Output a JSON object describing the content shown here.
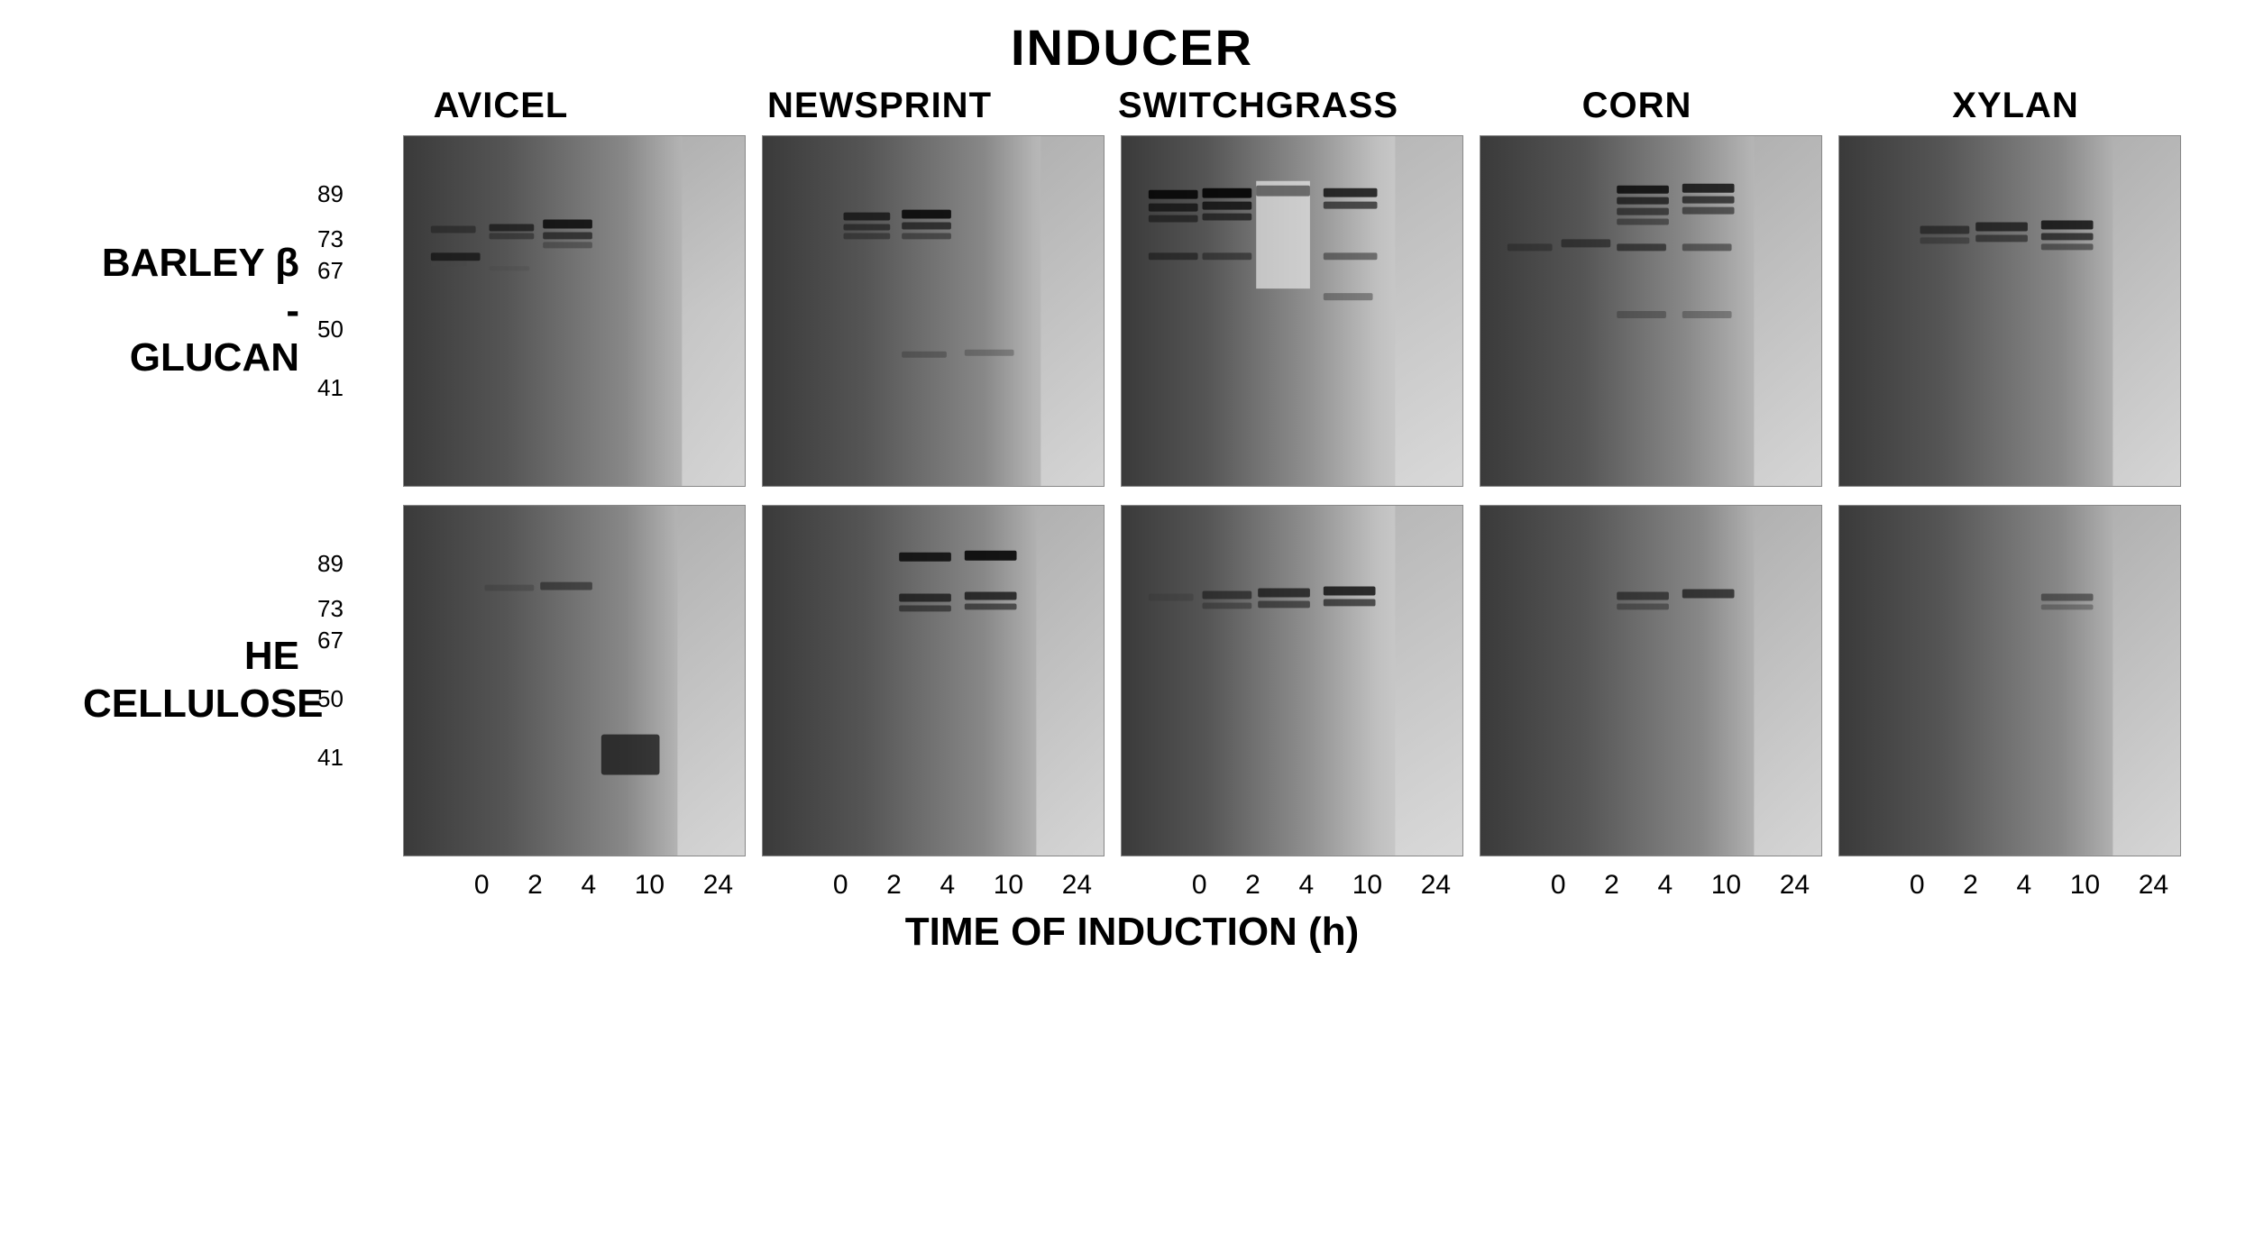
{
  "title": "INDUCER",
  "inducer_columns": [
    "AVICEL",
    "NEWSPRINT",
    "SWITCHGRASS",
    "CORN",
    "XYLAN"
  ],
  "row_labels": [
    "BARLEY β -\nGLUCAN",
    "HE\nCELLULOSE"
  ],
  "ladder_values": [
    "89",
    "73",
    "67",
    "50",
    "41"
  ],
  "time_points": [
    "0",
    "2",
    "4",
    "10",
    "24"
  ],
  "time_axis_label": "TIME OF INDUCTION (h)",
  "gel_rows": [
    {
      "name": "barley-beta-glucan",
      "label_line1": "BARLEY β -",
      "label_line2": "GLUCAN"
    },
    {
      "name": "he-cellulose",
      "label_line1": "HE",
      "label_line2": "CELLULOSE"
    }
  ],
  "colors": {
    "background": "#ffffff",
    "gel_dark": "#3a3a3a",
    "gel_mid": "#787878",
    "gel_light": "#d0d0d0",
    "band_dark": "#1a1a1a",
    "band_mid": "#555555",
    "text": "#000000"
  }
}
